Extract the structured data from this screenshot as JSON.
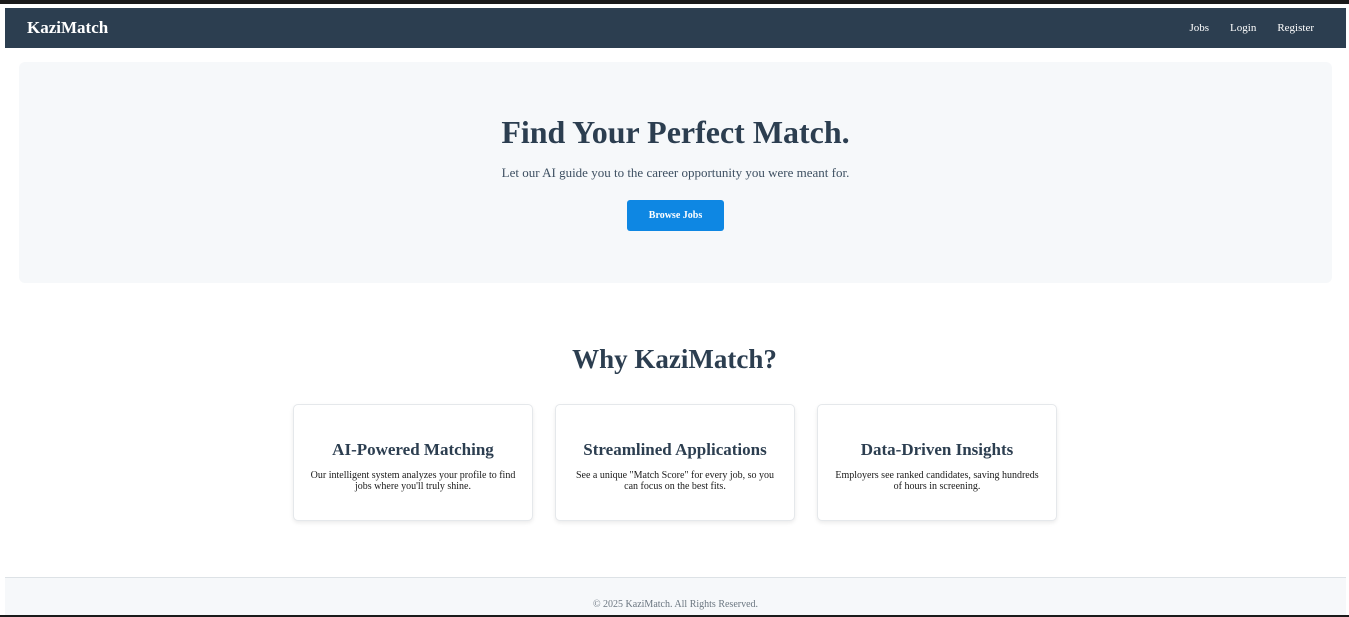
{
  "navbar": {
    "brand": "KaziMatch",
    "links": [
      "Jobs",
      "Login",
      "Register"
    ]
  },
  "hero": {
    "title": "Find Your Perfect Match.",
    "subtitle": "Let our AI guide you to the career opportunity you were meant for.",
    "cta_label": "Browse Jobs"
  },
  "features": {
    "title": "Why KaziMatch?",
    "cards": [
      {
        "title": "AI-Powered Matching",
        "text": "Our intelligent system analyzes your profile to find jobs where you'll truly shine."
      },
      {
        "title": "Streamlined Applications",
        "text": "See a unique \"Match Score\" for every job, so you can focus on the best fits."
      },
      {
        "title": "Data-Driven Insights",
        "text": "Employers see ranked candidates, saving hundreds of hours in screening."
      }
    ]
  },
  "footer": {
    "copyright": "© 2025 KaziMatch. All Rights Reserved."
  },
  "colors": {
    "navbar_bg": "#2c3e50",
    "accent": "#0e87e3",
    "hero_bg": "#f6f8fa",
    "heading": "#2c3e50"
  }
}
